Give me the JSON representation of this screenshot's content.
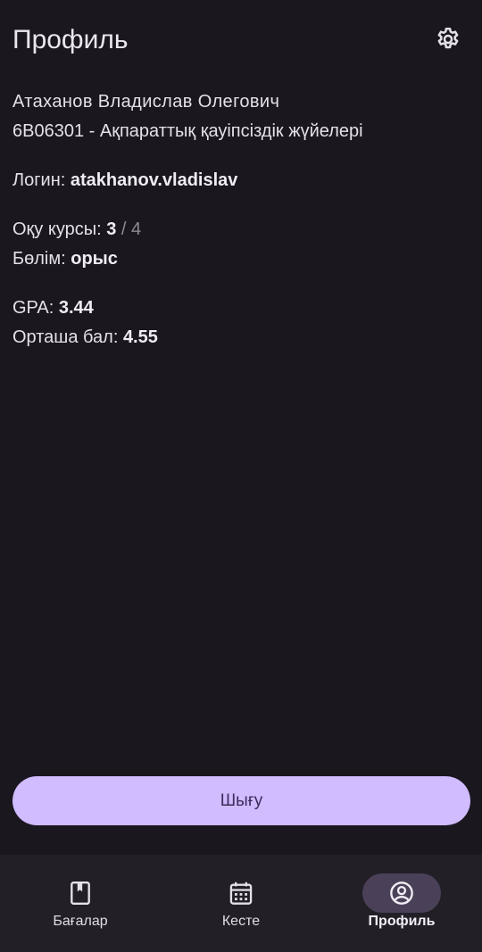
{
  "header": {
    "title": "Профиль",
    "settings_icon": "gear-icon"
  },
  "profile": {
    "full_name": "Атаханов Владислав Олегович",
    "program": "6B06301 - Ақпараттық қауіпсіздік жүйелері",
    "login_label": "Логин:",
    "login_value": "atakhanov.vladislav",
    "course_label": "Оқу курсы:",
    "course_value": "3",
    "course_total": "/ 4",
    "department_label": "Бөлім:",
    "department_value": "орыс",
    "gpa_label": "GPA:",
    "gpa_value": "3.44",
    "avg_label": "Орташа бал:",
    "avg_value": "4.55"
  },
  "actions": {
    "logout_label": "Шығу"
  },
  "nav": {
    "items": [
      {
        "label": "Бағалар",
        "icon": "bookmark-book-icon",
        "active": false
      },
      {
        "label": "Кесте",
        "icon": "calendar-icon",
        "active": false
      },
      {
        "label": "Профиль",
        "icon": "account-circle-icon",
        "active": true
      }
    ]
  },
  "colors": {
    "background": "#1a171f",
    "accent": "#d0bcff",
    "nav_background": "#221f27",
    "active_pill": "#4a4158"
  }
}
